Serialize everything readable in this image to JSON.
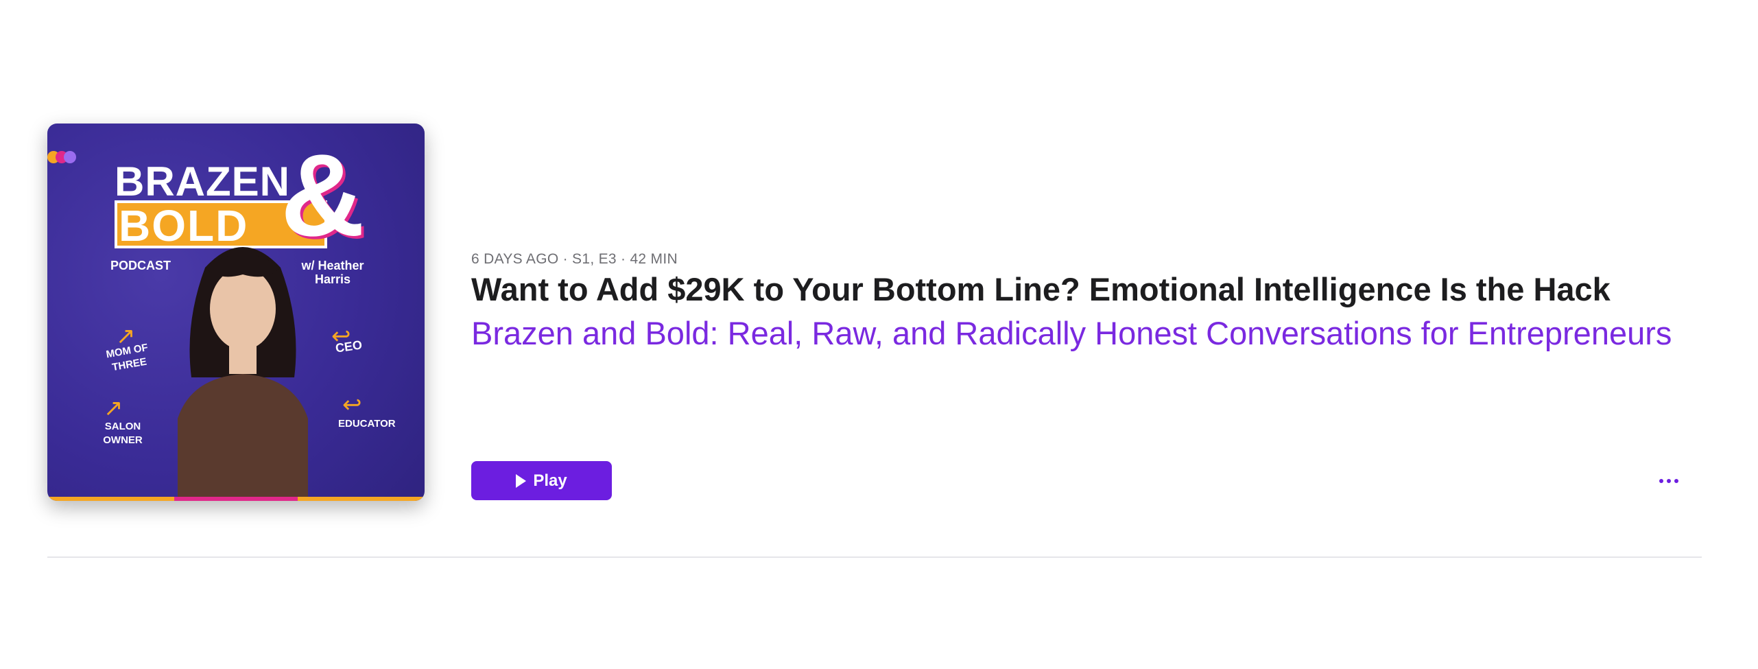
{
  "episode": {
    "meta": "6 DAYS AGO · S1, E3 · 42 MIN",
    "title": "Want to Add $29K to Your Bottom Line? Emotional Intelligence Is the Hack",
    "show": "Brazen and Bold: Real, Raw, and Radically Honest Conversations for Entrepreneurs",
    "play_label": "Play",
    "more_icon": "ellipsis-icon",
    "play_icon": "play-triangle-icon"
  },
  "artwork": {
    "line1": "BRAZEN",
    "line2": "BOLD",
    "amp": "&",
    "podcast": "PODCAST",
    "host": "w/ Heather Harris",
    "tag1": "MOM OF THREE",
    "tag2": "CEO",
    "tag3": "SALON OWNER",
    "tag4": "EDUCATOR"
  },
  "colors": {
    "accent": "#6c1ee0",
    "show_link": "#7a29e0",
    "art_bg": "#3a2b96",
    "art_orange": "#f5a623",
    "art_pink": "#e0288a"
  }
}
